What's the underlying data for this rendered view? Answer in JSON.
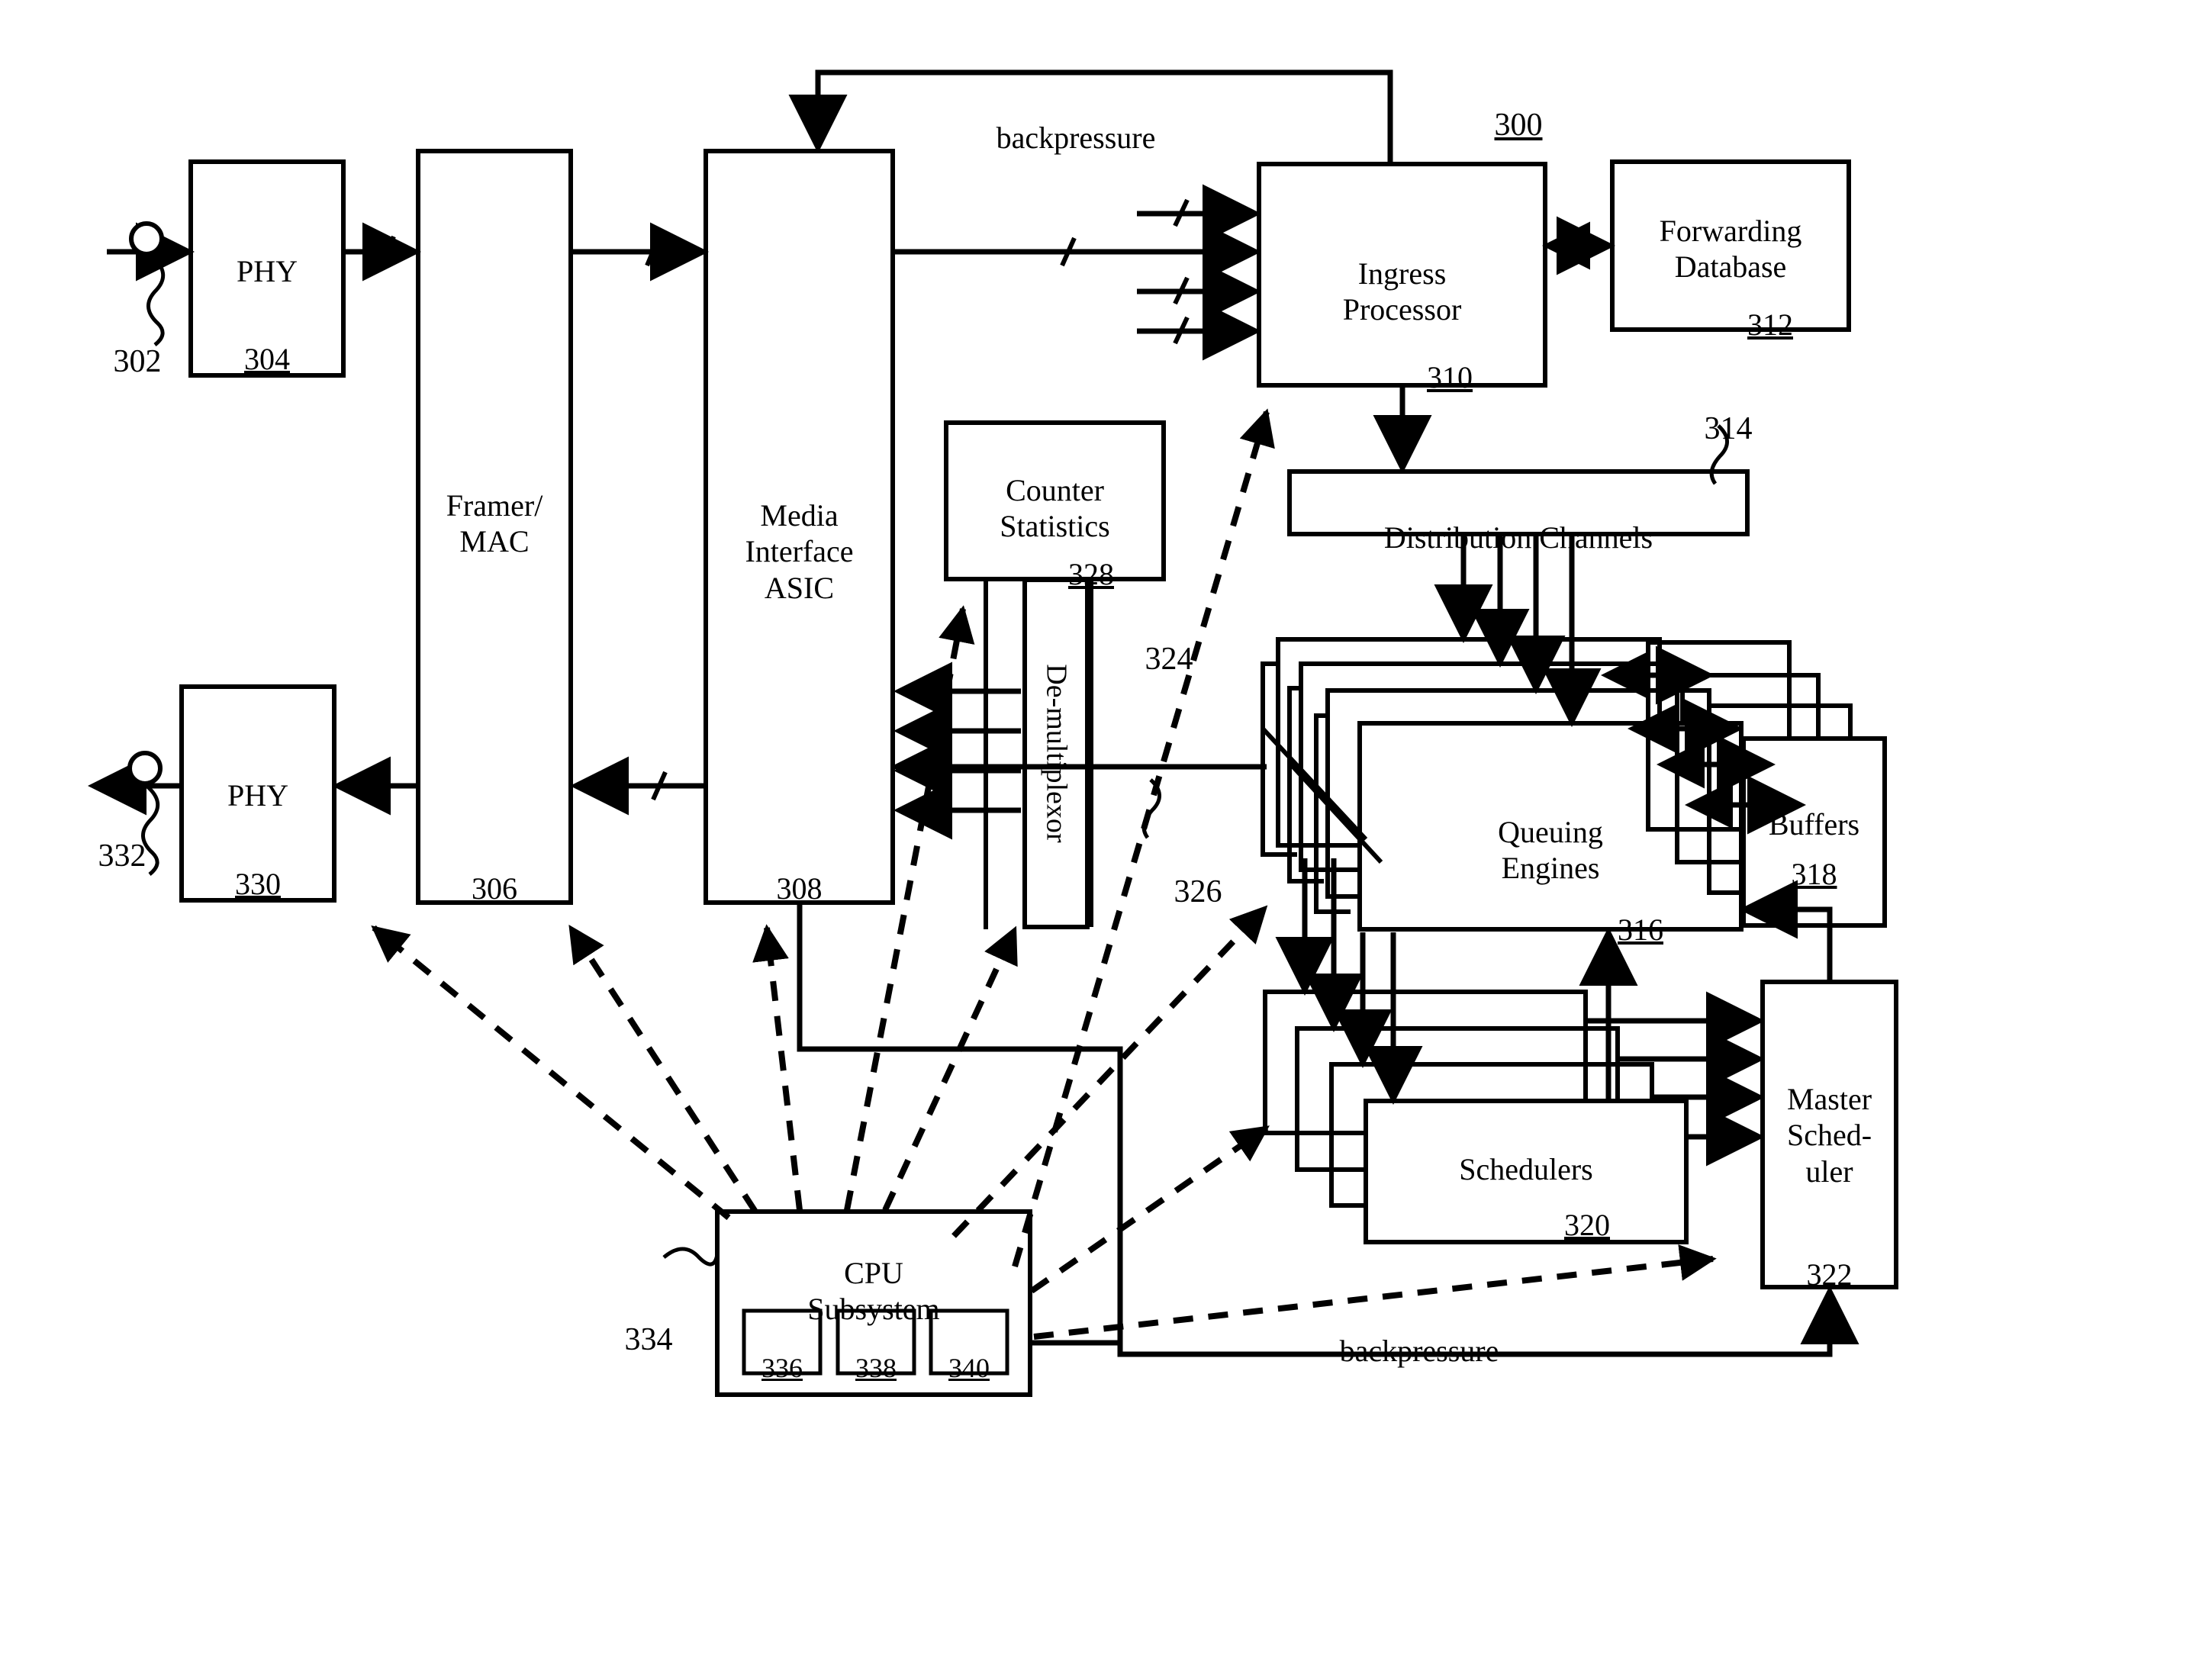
{
  "figure": {
    "figure_ref": "300",
    "blocks": [
      {
        "id": "phy_in",
        "label": "PHY",
        "ref": "304"
      },
      {
        "id": "framer",
        "label": "Framer/\nMAC",
        "ref": "306"
      },
      {
        "id": "mia",
        "label": "Media\nInterface\nASIC",
        "ref": "308"
      },
      {
        "id": "ingress",
        "label": "Ingress\nProcessor",
        "ref": "310"
      },
      {
        "id": "fwdb",
        "label": "Forwarding\nDatabase",
        "ref": "312"
      },
      {
        "id": "distch",
        "label": "Distribution Channels",
        "ref": "314"
      },
      {
        "id": "queuing",
        "label": "Queuing\nEngines",
        "ref": "316"
      },
      {
        "id": "buffers",
        "label": "Buffers",
        "ref": "318"
      },
      {
        "id": "sched",
        "label": "Schedulers",
        "ref": "320"
      },
      {
        "id": "mscheds",
        "label": "Master\nSched-\nuler",
        "ref": "322"
      },
      {
        "id": "counter",
        "label": "Counter\nStatistics",
        "ref": "328"
      },
      {
        "id": "demux",
        "label": "De-multiplexor",
        "ref": ""
      },
      {
        "id": "phy_out",
        "label": "PHY",
        "ref": "330"
      },
      {
        "id": "cpu",
        "label": "CPU\nSubsystem",
        "ref": ""
      },
      {
        "id": "cpu_336",
        "label": "",
        "ref": "336"
      },
      {
        "id": "cpu_338",
        "label": "",
        "ref": "338"
      },
      {
        "id": "cpu_340",
        "label": "",
        "ref": "340"
      }
    ],
    "edge_labels": [
      {
        "id": "bp_top",
        "text": "backpressure"
      },
      {
        "id": "bp_bottom",
        "text": "backpressure"
      }
    ],
    "callouts": [
      {
        "id": "c302",
        "text": "302"
      },
      {
        "id": "c332",
        "text": "332"
      },
      {
        "id": "c314",
        "text": "314"
      },
      {
        "id": "c324",
        "text": "324"
      },
      {
        "id": "c326",
        "text": "326"
      },
      {
        "id": "c334",
        "text": "334"
      },
      {
        "id": "c300",
        "text": "300"
      }
    ],
    "colors": {
      "ink": "#000000",
      "paper": "#ffffff"
    }
  }
}
